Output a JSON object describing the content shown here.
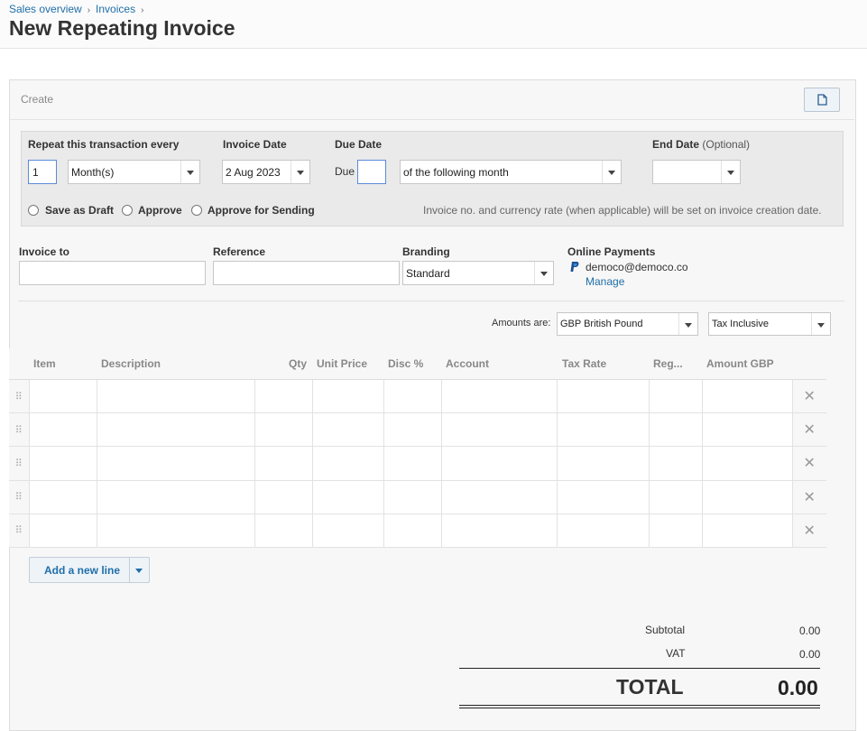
{
  "breadcrumb": {
    "items": [
      "Sales overview",
      "Invoices"
    ],
    "separator": "›"
  },
  "page_title": "New Repeating Invoice",
  "card": {
    "create_label": "Create"
  },
  "repeat": {
    "repeat_label": "Repeat this transaction every",
    "repeat_every_value": "1",
    "repeat_unit": "Month(s)",
    "invoice_date_label": "Invoice Date",
    "invoice_date_value": "2 Aug 2023",
    "due_date_label": "Due Date",
    "due_prefix": "Due",
    "due_day_value": "",
    "due_term": "of the following month",
    "end_date_label": "End Date",
    "end_date_optional": "(Optional)",
    "end_date_value": "",
    "radio_options": [
      "Save as Draft",
      "Approve",
      "Approve for Sending"
    ],
    "note": "Invoice no. and currency rate (when applicable) will be set on invoice creation date."
  },
  "details": {
    "invoice_to_label": "Invoice to",
    "invoice_to_value": "",
    "reference_label": "Reference",
    "reference_value": "",
    "branding_label": "Branding",
    "branding_value": "Standard",
    "online_payments_label": "Online Payments",
    "online_payments_email": "democo@democo.co",
    "manage_link": "Manage"
  },
  "amounts": {
    "label": "Amounts are:",
    "currency": "GBP British Pound",
    "tax_mode": "Tax Inclusive"
  },
  "table": {
    "columns": [
      "Item",
      "Description",
      "Qty",
      "Unit Price",
      "Disc %",
      "Account",
      "Tax Rate",
      "Reg...",
      "Amount GBP"
    ],
    "row_count": 5,
    "delete_glyph": "✕",
    "handle_glyph": "⠿"
  },
  "add_line": {
    "label": "Add a new line"
  },
  "totals": {
    "subtotal_label": "Subtotal",
    "subtotal_value": "0.00",
    "vat_label": "VAT",
    "vat_value": "0.00",
    "total_label": "TOTAL",
    "total_value": "0.00"
  },
  "colors": {
    "link": "#1f6ea8",
    "panel": "#eaeaea",
    "card": "#f7f7f7",
    "focus_border": "#5b8ad8"
  }
}
